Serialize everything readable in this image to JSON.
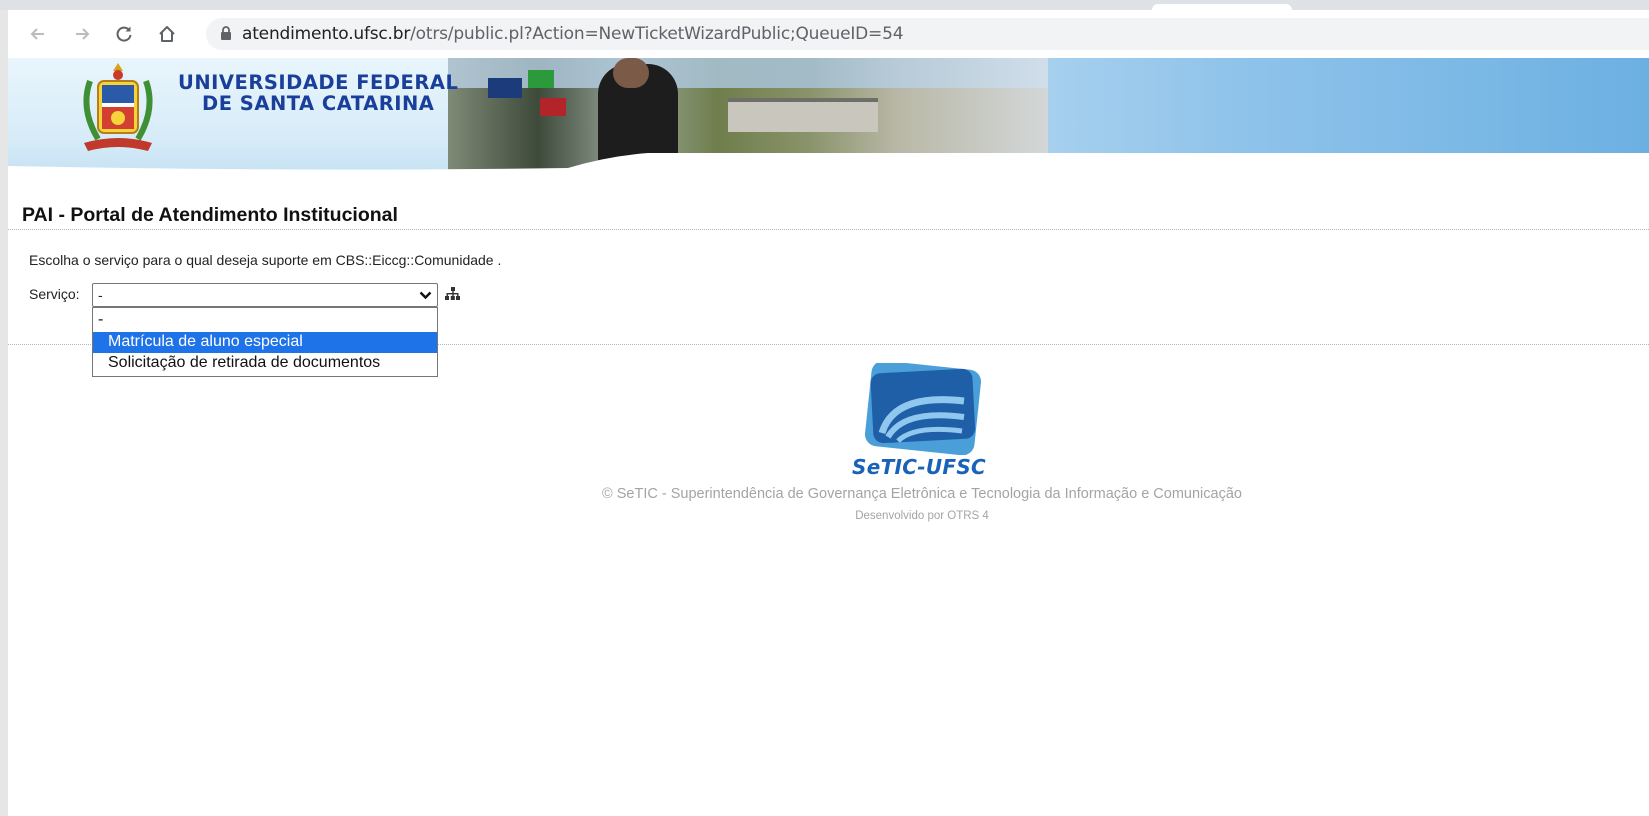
{
  "browser": {
    "url_host": "atendimento.ufsc.br",
    "url_path": "/otrs/public.pl?Action=NewTicketWizardPublic;QueueID=54"
  },
  "header": {
    "university_line1": "UNIVERSIDADE FEDERAL",
    "university_line2": "DE SANTA CATARINA"
  },
  "main": {
    "title": "PAI - Portal de Atendimento Institucional",
    "instruction": "Escolha o serviço para o qual deseja suporte em CBS::Eiccg::Comunidade .",
    "service_label": "Serviço:",
    "service_value": "-",
    "service_options": [
      "-",
      "Matrícula de aluno especial",
      "Solicitação de retirada de documentos"
    ],
    "highlighted_option": "Matrícula de aluno especial"
  },
  "footer": {
    "logo_text": "SeTIC-UFSC",
    "copyright": "© SeTIC - Superintendência de Governança Eletrônica e Tecnologia da Informação e Comunicação",
    "powered_by": "Desenvolvido por OTRS 4"
  },
  "colors": {
    "highlight": "#1e73e8",
    "university_blue": "#1a3f9a",
    "setic_blue": "#1a62b8",
    "footer_grey": "#a4a4a4"
  },
  "icons": [
    "back-arrow-icon",
    "forward-arrow-icon",
    "reload-icon",
    "home-icon",
    "lock-icon",
    "chevron-down-icon",
    "tree-icon"
  ]
}
